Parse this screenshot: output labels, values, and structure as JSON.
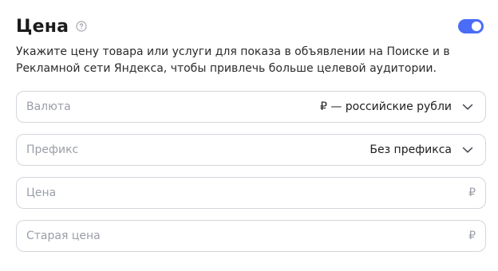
{
  "section": {
    "title": "Цена",
    "description": "Укажите цену товара или услуги для показа в объявлении на Поиске и в Рекламной сети Яндекса, чтобы привлечь больше целевой аудитории.",
    "toggle_on": true
  },
  "fields": {
    "currency": {
      "label": "Валюта",
      "value": "₽ — российские рубли"
    },
    "prefix": {
      "label": "Префикс",
      "value": "Без префикса"
    },
    "price": {
      "placeholder": "Цена",
      "suffix": "₽"
    },
    "old_price": {
      "placeholder": "Старая цена",
      "suffix": "₽"
    }
  },
  "icons": {
    "help": "help-circle-icon",
    "chevron": "chevron-down-icon"
  },
  "colors": {
    "accent": "#4a6cf7",
    "border": "#d3d6dd",
    "placeholder": "#9a9ea6",
    "text": "#1b1b1b"
  }
}
